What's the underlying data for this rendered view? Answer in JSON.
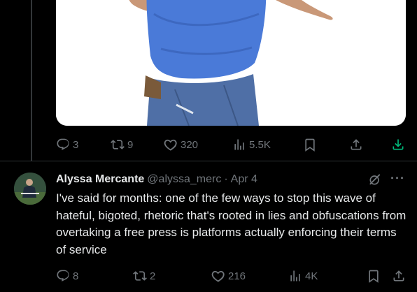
{
  "previous_post": {
    "media_alt": "",
    "actions": {
      "reply_count": "3",
      "repost_count": "9",
      "like_count": "320",
      "view_count": "5.5K"
    }
  },
  "post": {
    "author_name": "Alyssa Mercante",
    "handle": "@alyssa_merc",
    "separator": "·",
    "date": "Apr 4",
    "text": "I've said for months: one of the few ways to stop this wave of hateful, bigoted, rhetoric that's rooted in lies and obfuscations from overtaking a free press is platforms actually enforcing their terms of service",
    "actions": {
      "reply_count": "8",
      "repost_count": "2",
      "like_count": "216",
      "view_count": "4K"
    },
    "more_label": "···"
  },
  "icons": {
    "reply": "reply-icon",
    "repost": "repost-icon",
    "like": "heart-icon",
    "views": "views-icon",
    "bookmark": "bookmark-icon",
    "share": "share-icon",
    "download": "download-icon",
    "grok": "grok-icon",
    "more": "more-icon"
  },
  "colors": {
    "background": "#000000",
    "text": "#e7e9ea",
    "muted": "#71767b",
    "download_accent": "#00ba7c",
    "divider": "#2f3336"
  }
}
